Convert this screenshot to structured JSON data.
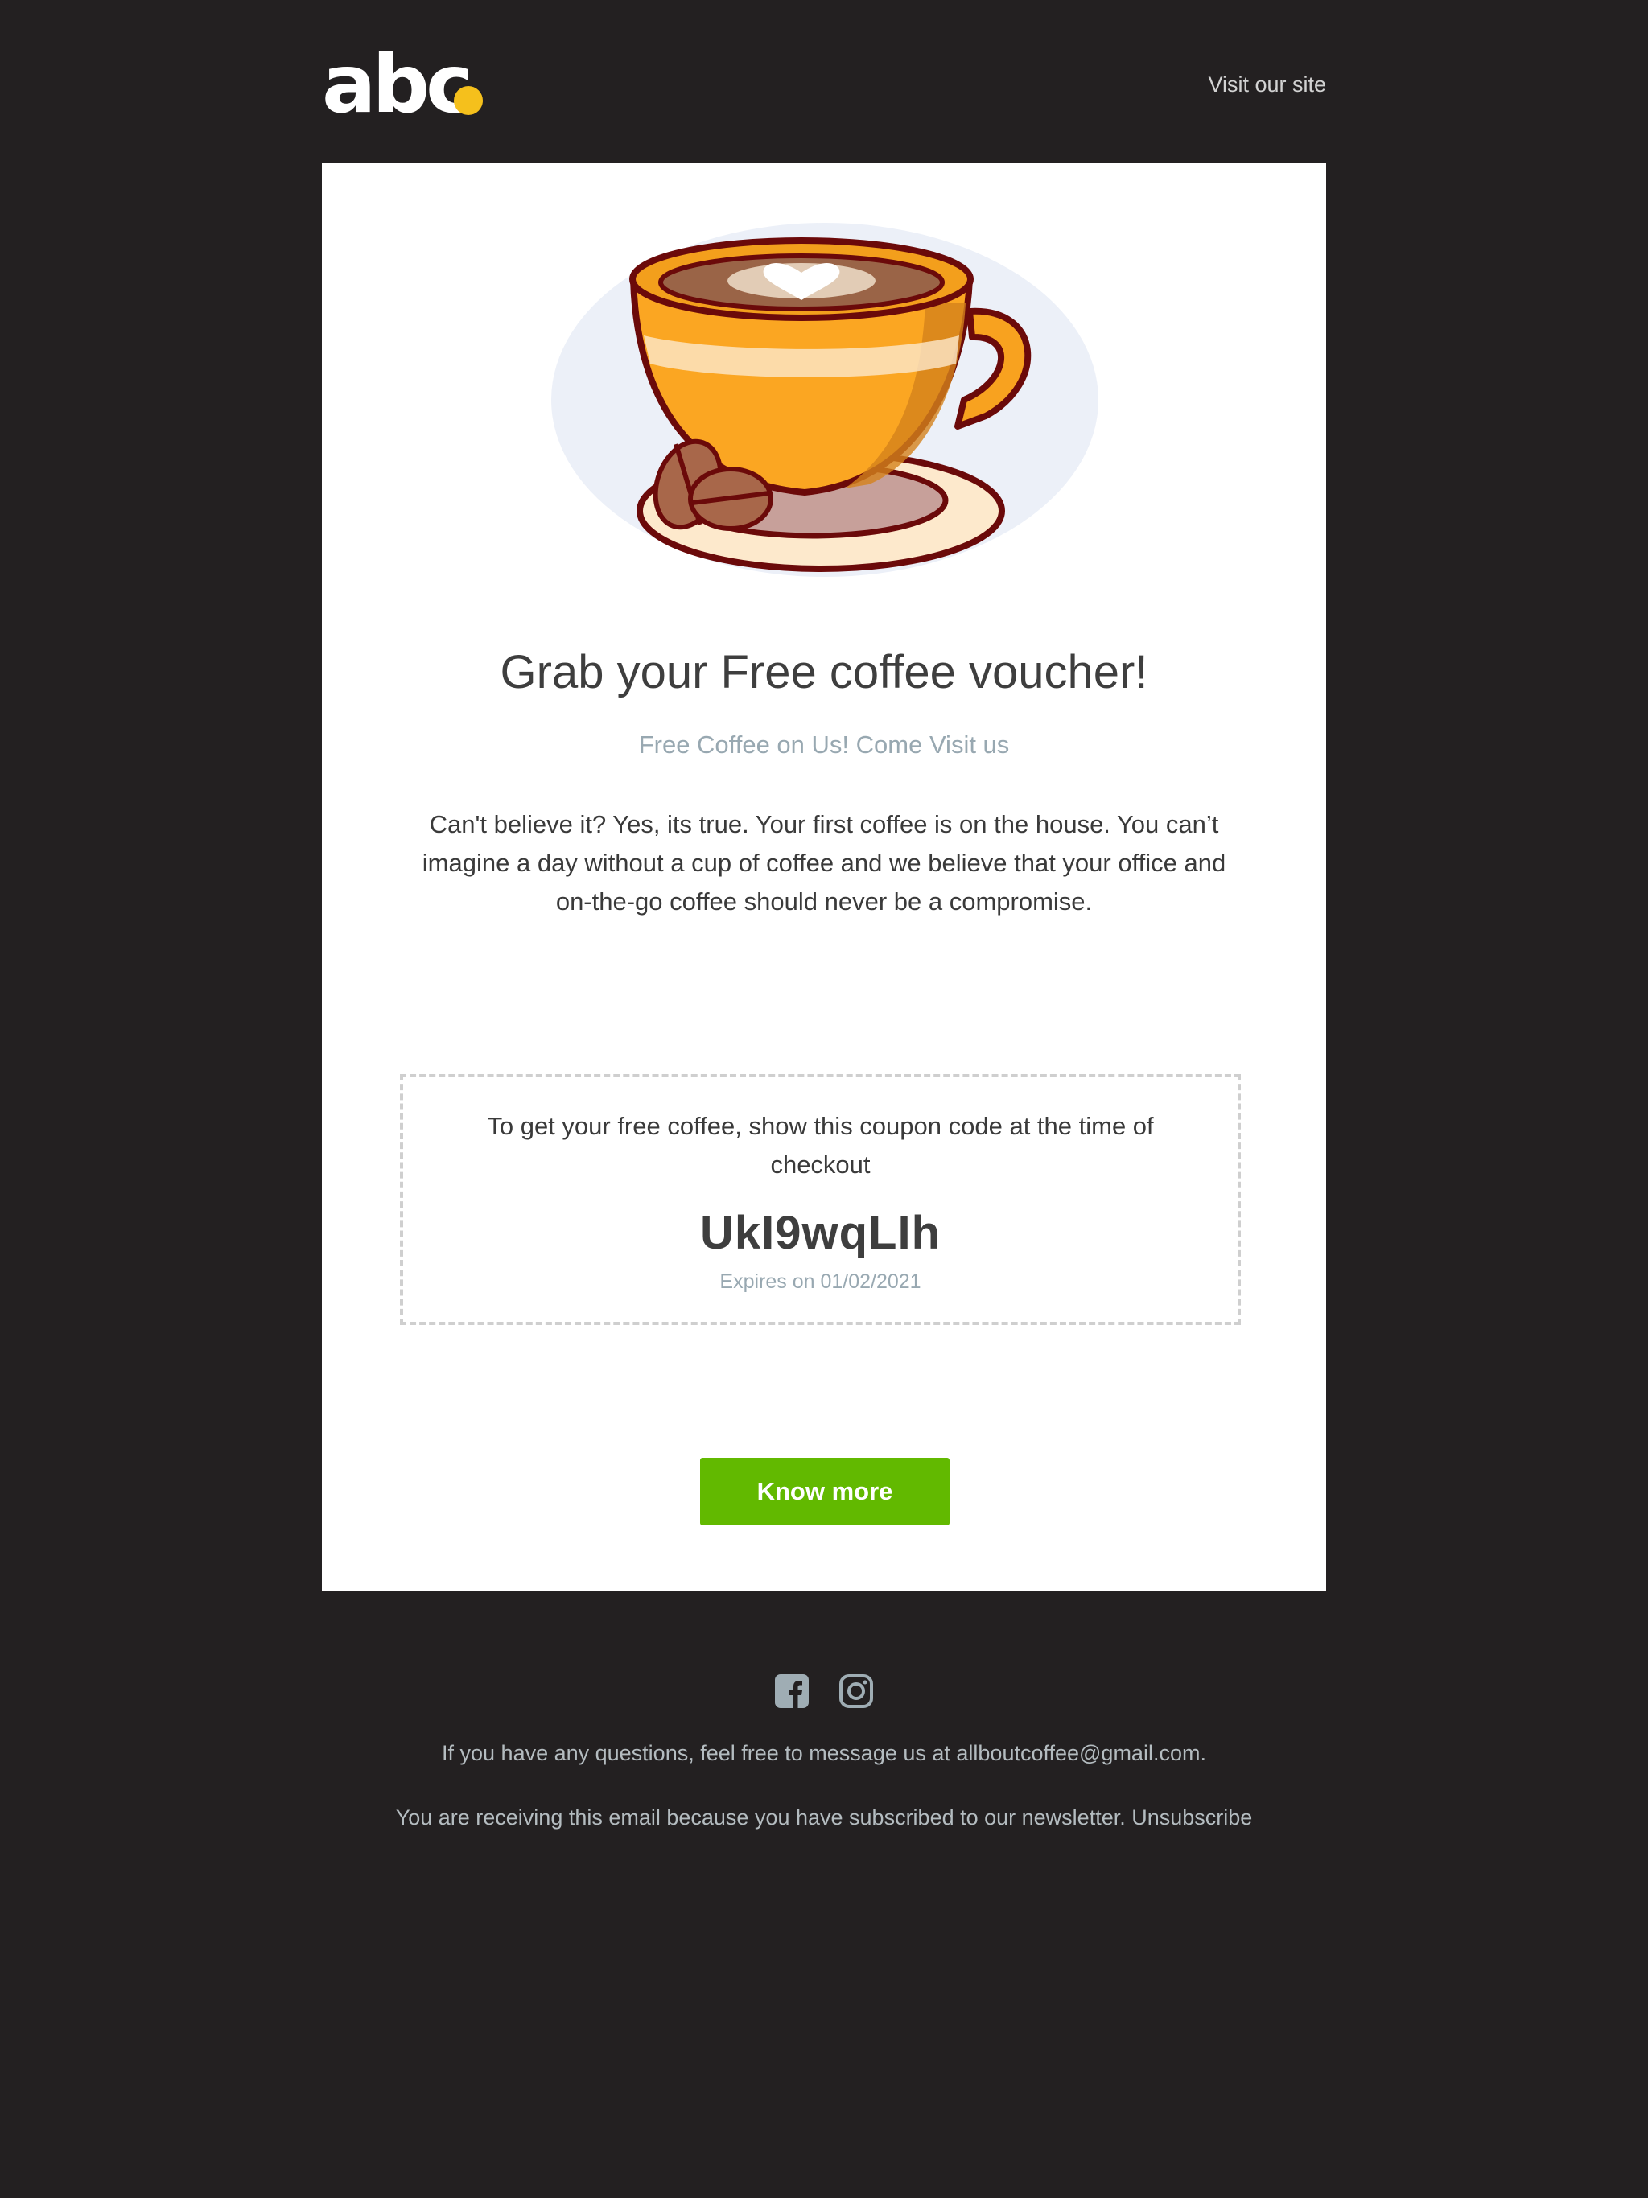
{
  "header": {
    "logo_text": "abc",
    "visit_label": "Visit our site"
  },
  "hero": {
    "image_icon": "coffee-cup-illustration",
    "title": "Grab your Free coffee voucher!",
    "subtitle": "Free Coffee on Us! Come Visit us",
    "body": "Can't believe it? Yes, its true. Your first coffee is on the house. You can’t imagine a day without a cup of coffee and we believe that your office and on-the-go coffee should never be a compromise."
  },
  "coupon": {
    "instruction": "To get your free coffee, show this coupon code at the time of checkout",
    "code": "UkI9wqLIh",
    "expiry": "Expires on 01/02/2021"
  },
  "cta": {
    "label": "Know more"
  },
  "footer": {
    "social_icons": [
      "facebook-icon",
      "instagram-icon"
    ],
    "contact": "If you have any questions, feel free to message us at allboutcoffee@gmail.com.",
    "subscription": "You are receiving this email because you have subscribed to our newsletter. Unsubscribe"
  },
  "colors": {
    "background": "#232021",
    "card": "#ffffff",
    "accent_dot": "#f5c01c",
    "button": "#62b900",
    "muted_text": "#98a8b1"
  }
}
